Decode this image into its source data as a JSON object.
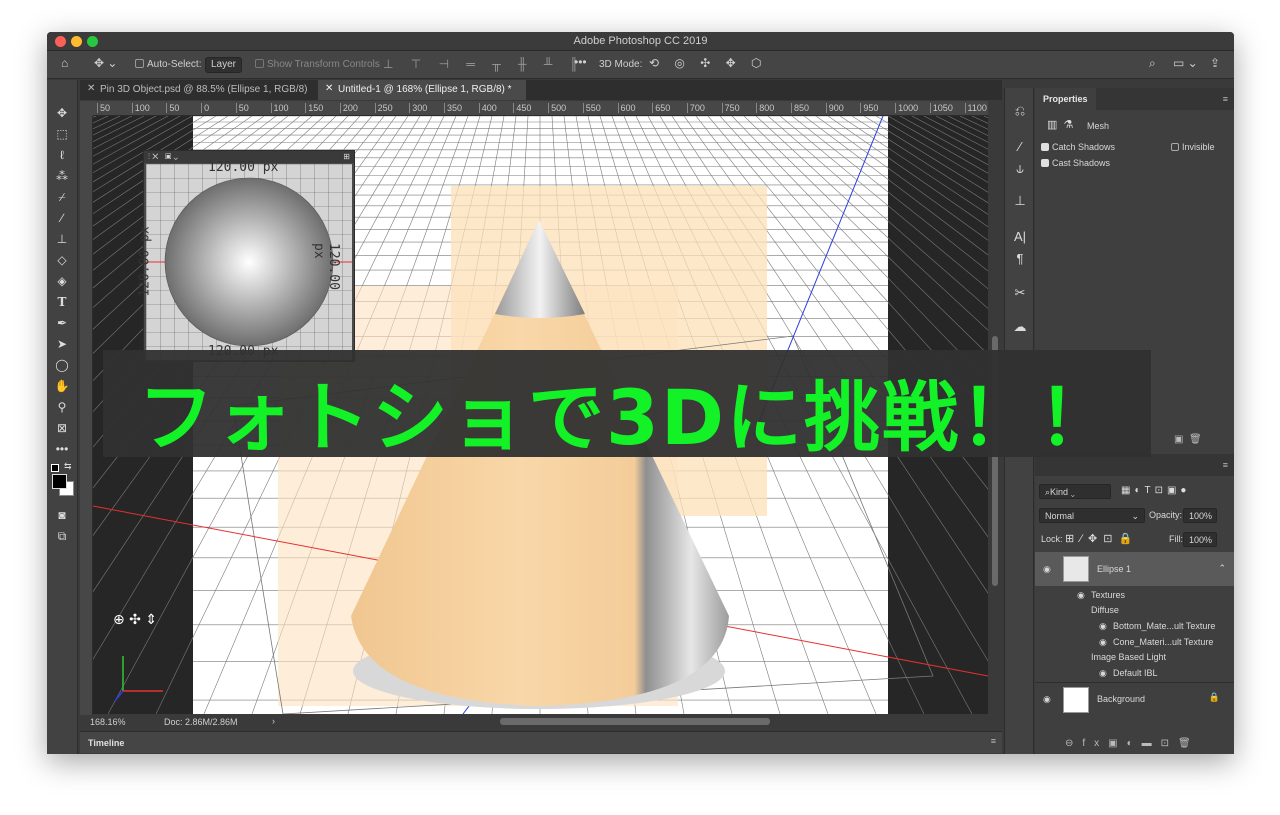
{
  "window": {
    "title": "Adobe Photoshop CC 2019"
  },
  "options_bar": {
    "auto_select_label": "Auto-Select:",
    "auto_select_value": "Layer",
    "show_transform_label": "Show Transform Controls",
    "mode_label": "3D Mode:"
  },
  "doc_tabs": [
    {
      "label": "Pin 3D Object.psd @ 88.5% (Ellipse 1, RGB/8)",
      "active": false
    },
    {
      "label": "Untitled-1 @ 168% (Ellipse 1, RGB/8) *",
      "active": true
    }
  ],
  "ruler_top_ticks": [
    "50",
    "100",
    "50",
    "0",
    "50",
    "100",
    "150",
    "200",
    "250",
    "300",
    "350",
    "400",
    "450",
    "500",
    "550",
    "600",
    "650",
    "700",
    "750",
    "800",
    "850",
    "900",
    "950",
    "1000",
    "1050",
    "1100"
  ],
  "secondary_view": {
    "top_label": "120.00 px",
    "bottom_label": "120.00 px",
    "left_label": "120.00 px",
    "right_label": "120.00 px"
  },
  "banner": {
    "text": "フォトショで3Dに挑戦！！"
  },
  "status": {
    "zoom": "168.16%",
    "doc": "Doc: 2.86M/2.86M"
  },
  "timeline": {
    "label": "Timeline"
  },
  "properties": {
    "tab": "Properties",
    "mesh_label": "Mesh",
    "catch_shadows": "Catch Shadows",
    "invisible": "Invisible",
    "cast_shadows": "Cast Shadows"
  },
  "layers": {
    "filter_kind": "Kind",
    "blend_mode": "Normal",
    "opacity_label": "Opacity:",
    "opacity_value": "100%",
    "lock_label": "Lock:",
    "fill_label": "Fill:",
    "fill_value": "100%",
    "items": [
      {
        "name": "Ellipse 1"
      },
      {
        "name": "Textures"
      },
      {
        "name": "Diffuse"
      },
      {
        "name": "Bottom_Mate...ult Texture"
      },
      {
        "name": "Cone_Materi...ult Texture"
      },
      {
        "name": "Image Based Light"
      },
      {
        "name": "Default IBL"
      },
      {
        "name": "Background"
      }
    ]
  },
  "colors": {
    "accent_green": "#13f226",
    "cone": "#f3c990",
    "panel_bg": "#3f3f3f"
  }
}
